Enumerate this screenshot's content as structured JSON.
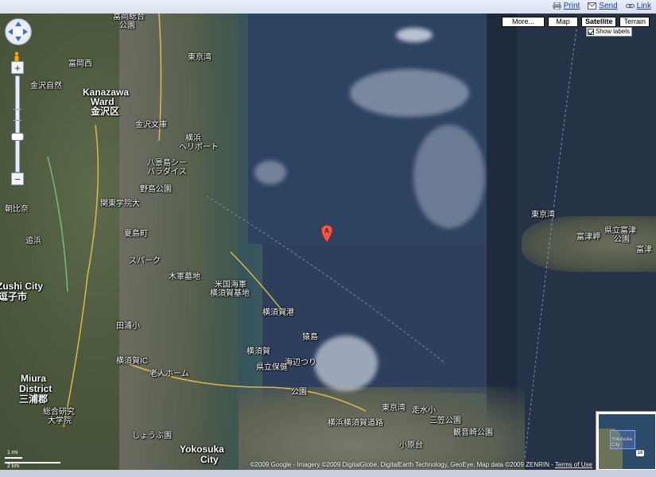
{
  "toolbar": {
    "print": "Print",
    "send": "Send",
    "link": "Link"
  },
  "map_types": {
    "more": "More...",
    "map": "Map",
    "satellite": "Satellite",
    "terrain": "Terrain",
    "show_labels": "Show labels"
  },
  "zoom": {
    "plus": "+",
    "minus": "−"
  },
  "labels": [
    {
      "id": "l1",
      "text": "冨岡総合"
    },
    {
      "id": "l2",
      "text": "公園"
    },
    {
      "id": "l3",
      "text": "富岡西"
    },
    {
      "id": "l4",
      "text": "東京湾"
    },
    {
      "id": "l5",
      "text": "Kanazawa"
    },
    {
      "id": "l6",
      "text": "Ward"
    },
    {
      "id": "l7",
      "text": "金沢区"
    },
    {
      "id": "l8",
      "text": "金沢自然"
    },
    {
      "id": "l9",
      "text": "金沢文庫"
    },
    {
      "id": "l10",
      "text": "八景島シー"
    },
    {
      "id": "l11",
      "text": "パラダイス"
    },
    {
      "id": "l12",
      "text": "横浜"
    },
    {
      "id": "l13",
      "text": "ヘリポート"
    },
    {
      "id": "l14",
      "text": "野島公園"
    },
    {
      "id": "l15",
      "text": "関東学院大"
    },
    {
      "id": "l16",
      "text": "朝比奈"
    },
    {
      "id": "l17",
      "text": "追浜"
    },
    {
      "id": "l18",
      "text": "夏島町"
    },
    {
      "id": "l19",
      "text": "スパーク"
    },
    {
      "id": "l20",
      "text": "木軍墓地"
    },
    {
      "id": "l21",
      "text": "米国海軍"
    },
    {
      "id": "l22",
      "text": "横須賀基地"
    },
    {
      "id": "l23",
      "text": "横須賀港"
    },
    {
      "id": "l24",
      "text": "猿島"
    },
    {
      "id": "l25",
      "text": "Zushi City"
    },
    {
      "id": "l26",
      "text": "逗子市"
    },
    {
      "id": "l27",
      "text": "田浦小"
    },
    {
      "id": "l28",
      "text": "横須賀IC"
    },
    {
      "id": "l29",
      "text": "老人ホーム"
    },
    {
      "id": "l30",
      "text": "横須賀"
    },
    {
      "id": "l31",
      "text": "県立保健"
    },
    {
      "id": "l32",
      "text": "海辺つり"
    },
    {
      "id": "l33",
      "text": "公園"
    },
    {
      "id": "l34",
      "text": "Miura"
    },
    {
      "id": "l35",
      "text": "District"
    },
    {
      "id": "l36",
      "text": "三浦郡"
    },
    {
      "id": "l37",
      "text": "総合研究"
    },
    {
      "id": "l38",
      "text": "大学院"
    },
    {
      "id": "l39",
      "text": "しょうぶ園"
    },
    {
      "id": "l40",
      "text": "Yokosuka"
    },
    {
      "id": "l41",
      "text": "City"
    },
    {
      "id": "l42",
      "text": "東京湾"
    },
    {
      "id": "l43",
      "text": "走水小"
    },
    {
      "id": "l44",
      "text": "観音崎公園"
    },
    {
      "id": "l45",
      "text": "東京湾"
    },
    {
      "id": "l46",
      "text": "富津岬"
    },
    {
      "id": "l47",
      "text": "県立富津"
    },
    {
      "id": "l48",
      "text": "公園"
    },
    {
      "id": "l49",
      "text": "小原台"
    },
    {
      "id": "l50",
      "text": "三笠公園"
    },
    {
      "id": "l51",
      "text": "横浜横須賀道路"
    },
    {
      "id": "l52",
      "text": "富津"
    }
  ],
  "marker": {
    "letter": "A"
  },
  "scale": {
    "top": "1 mi",
    "bottom": "2 km"
  },
  "copyright": {
    "text": "©2009 Google - Imagery ©2009 DigitalGlobe, DigitalEarth Technology, GeoEye, Map data ©2009 ZENRIN -",
    "terms": "Terms of Use"
  },
  "overview": {
    "label": "Yokosuka\nCity",
    "badge": "16"
  }
}
